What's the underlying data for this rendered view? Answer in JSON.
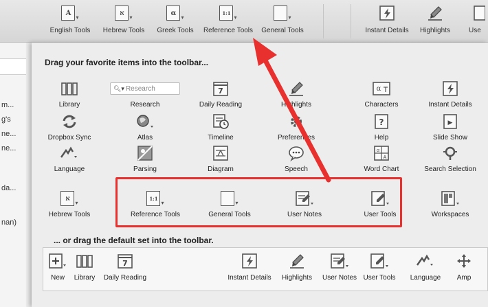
{
  "toolbar": {
    "items": [
      {
        "label": "English Tools",
        "glyph": "A"
      },
      {
        "label": "Hebrew Tools",
        "glyph": "א"
      },
      {
        "label": "Greek Tools",
        "glyph": "α"
      },
      {
        "label": "Reference Tools",
        "glyph": "1:1"
      },
      {
        "label": "General Tools",
        "glyph": ""
      },
      {
        "label": "Instant Details",
        "glyph": ""
      },
      {
        "label": "Highlights",
        "glyph": ""
      },
      {
        "label": "Use",
        "glyph": ""
      }
    ]
  },
  "left_pane": {
    "lines": [
      "m...",
      "g's",
      "ne...",
      "ne...",
      "da...",
      "nan)"
    ]
  },
  "sheet": {
    "drag_favorites_heading": "Drag your favorite items into the toolbar...",
    "drag_default_heading": "... or drag the default set into the toolbar.",
    "research_placeholder": "Research",
    "items": [
      {
        "label": "Library",
        "icon": "library-icon"
      },
      {
        "label": "Research",
        "icon": "research-field"
      },
      {
        "label": "Daily Reading",
        "icon": "calendar-icon",
        "glyph": "7"
      },
      {
        "label": "Highlights",
        "icon": "highlighter-icon"
      },
      {
        "label": "Characters",
        "icon": "characters-icon",
        "glyph": "α"
      },
      {
        "label": "Instant Details",
        "icon": "instant-details-icon"
      },
      {
        "label": "Dropbox Sync",
        "icon": "sync-icon"
      },
      {
        "label": "Atlas",
        "icon": "globe-icon"
      },
      {
        "label": "Timeline",
        "icon": "timeline-icon"
      },
      {
        "label": "Preferences",
        "icon": "gear-icon"
      },
      {
        "label": "Help",
        "icon": "help-icon",
        "glyph": "?"
      },
      {
        "label": "Slide Show",
        "icon": "slideshow-icon",
        "glyph": "▶"
      },
      {
        "label": "Language",
        "icon": "language-icon"
      },
      {
        "label": "Parsing",
        "icon": "parsing-icon"
      },
      {
        "label": "Diagram",
        "icon": "diagram-icon"
      },
      {
        "label": "Speech",
        "icon": "speech-icon"
      },
      {
        "label": "Word Chart",
        "icon": "word-chart-icon"
      },
      {
        "label": "Search Selection",
        "icon": "search-selection-icon"
      },
      {
        "label": "Hebrew Tools",
        "icon": "hebrew-tools-icon",
        "glyph": "א"
      },
      {
        "label": "Reference Tools",
        "icon": "reference-tools-icon",
        "glyph": "1:1"
      },
      {
        "label": "General Tools",
        "icon": "general-tools-icon"
      },
      {
        "label": "User Notes",
        "icon": "user-notes-icon"
      },
      {
        "label": "User Tools",
        "icon": "user-tools-icon"
      },
      {
        "label": "Workspaces",
        "icon": "workspaces-icon"
      }
    ],
    "default_set": [
      {
        "label": "New"
      },
      {
        "label": "Library"
      },
      {
        "label": "Daily Reading",
        "glyph": "7"
      },
      {
        "label": "Instant Details"
      },
      {
        "label": "Highlights"
      },
      {
        "label": "User Notes"
      },
      {
        "label": "User Tools"
      },
      {
        "label": "Language"
      },
      {
        "label": "Amp"
      }
    ]
  },
  "colors": {
    "annotation_red": "#e8312f"
  }
}
